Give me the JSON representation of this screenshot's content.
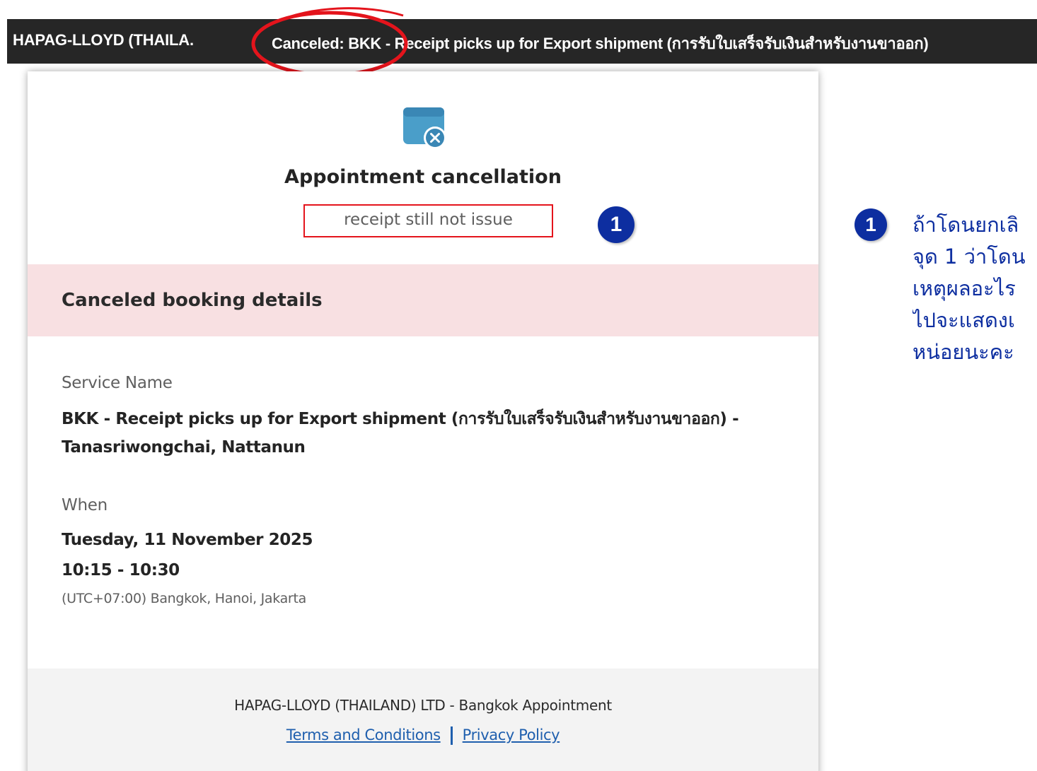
{
  "header": {
    "sender": "HAPAG-LLOYD (THAILA.",
    "subject": "Canceled: BKK - Receipt picks up for Export shipment (การรับใบเสร็จรับเงินสำหรับงานขาออก)",
    "highlight_color": "#e4141c"
  },
  "card": {
    "icon": "calendar-cancel-icon",
    "title": "Appointment cancellation",
    "reason": "receipt still not issue",
    "section_heading": "Canceled booking details",
    "service_label": "Service Name",
    "service_value": "BKK - Receipt picks up for Export shipment (การรับใบเสร็จรับเงินสำหรับงานขาออก) - Tanasriwongchai, Nattanun",
    "when_label": "When",
    "date_value": "Tuesday, 11 November 2025",
    "time_value": "10:15 - 10:30",
    "timezone_value": "(UTC+07:00) Bangkok, Hanoi, Jakarta",
    "footer_org": "HAPAG-LLOYD (THAILAND) LTD - Bangkok Appointment",
    "terms_link": "Terms and Conditions",
    "privacy_link": "Privacy Policy"
  },
  "annotation": {
    "badge_number": "1",
    "lines": [
      "ถ้าโดนยกเลิ",
      "จุด 1 ว่าโดน",
      "เหตุผลอะไร",
      "ไปจะแสดงเ",
      "หน่อยนะคะ"
    ],
    "color": "#0d2ea0"
  }
}
